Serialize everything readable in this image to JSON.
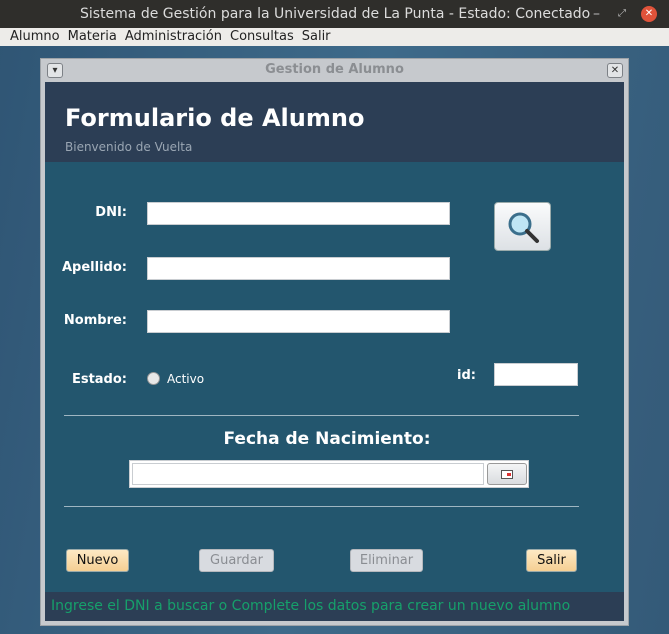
{
  "window": {
    "title": "Sistema de Gestión para la Universidad de La Punta - Estado: Conectado"
  },
  "menu": [
    "Alumno",
    "Materia",
    "Administración",
    "Consultas",
    "Salir"
  ],
  "frame": {
    "title": "Gestion de Alumno"
  },
  "header": {
    "title": "Formulario de Alumno",
    "subtitle": "Bienvenido de Vuelta"
  },
  "form": {
    "dni_label": "DNI:",
    "apellido_label": "Apellido:",
    "nombre_label": "Nombre:",
    "estado_label": "Estado:",
    "activo_label": "Activo",
    "id_label": "id:",
    "fecha_label": "Fecha de Nacimiento:",
    "dni": "",
    "apellido": "",
    "nombre": "",
    "id": "",
    "fecha": ""
  },
  "buttons": {
    "nuevo": "Nuevo",
    "guardar": "Guardar",
    "eliminar": "Eliminar",
    "salir": "Salir"
  },
  "status": "Ingrese el DNI a buscar o Complete los datos para crear un nuevo alumno"
}
